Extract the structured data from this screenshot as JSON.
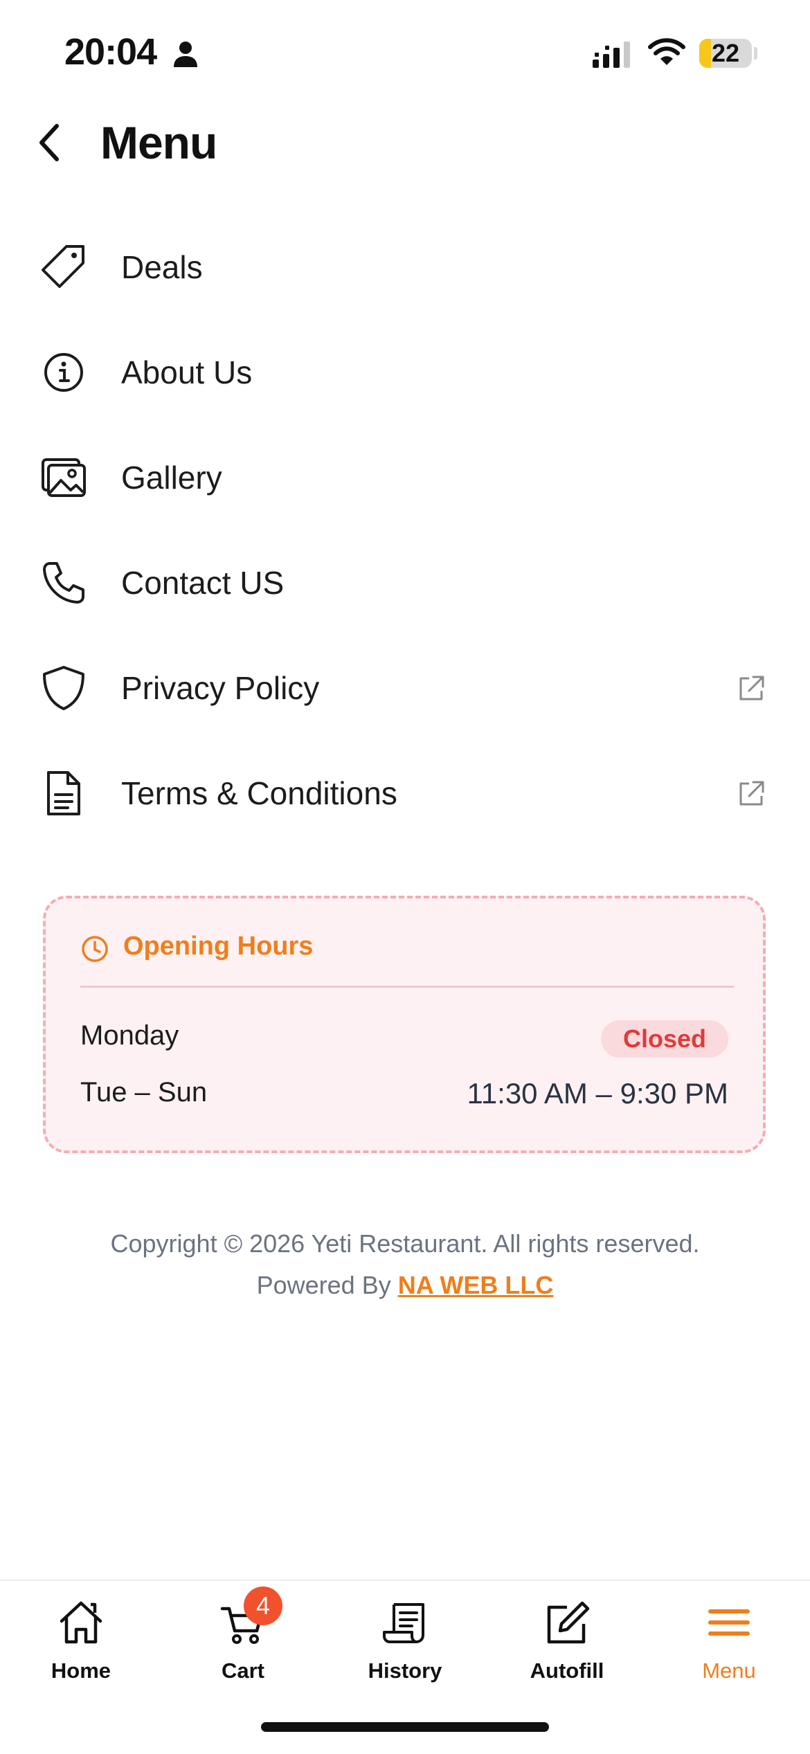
{
  "status_bar": {
    "time": "20:04",
    "battery_level": "22",
    "battery_fraction": 0.22,
    "icons": [
      "person-icon",
      "signal-icon",
      "wifi-icon",
      "battery-icon"
    ]
  },
  "header": {
    "title": "Menu",
    "back_icon": "chevron-left-icon"
  },
  "menu": {
    "items": [
      {
        "label": "Deals",
        "icon": "tag-icon",
        "external": false
      },
      {
        "label": "About Us",
        "icon": "info-icon",
        "external": false
      },
      {
        "label": "Gallery",
        "icon": "image-icon",
        "external": false
      },
      {
        "label": "Contact US",
        "icon": "phone-icon",
        "external": false
      },
      {
        "label": "Privacy Policy",
        "icon": "shield-icon",
        "external": true
      },
      {
        "label": "Terms & Conditions",
        "icon": "document-icon",
        "external": true
      }
    ]
  },
  "opening_hours": {
    "title": "Opening Hours",
    "rows": [
      {
        "day": "Monday",
        "status": "Closed"
      },
      {
        "day": "Tue – Sun",
        "hours": "11:30 AM – 9:30 PM"
      }
    ]
  },
  "footer": {
    "copyright": "Copyright © 2026 Yeti Restaurant. All rights reserved.",
    "powered_prefix": "Powered By",
    "powered_link": "NA WEB LLC"
  },
  "tab_bar": {
    "tabs": [
      {
        "label": "Home",
        "icon": "home-icon"
      },
      {
        "label": "Cart",
        "icon": "cart-icon",
        "badge": "4"
      },
      {
        "label": "History",
        "icon": "receipt-icon"
      },
      {
        "label": "Autofill",
        "icon": "edit-icon"
      },
      {
        "label": "Menu",
        "icon": "hamburger-icon",
        "active": true
      }
    ]
  },
  "colors": {
    "accent": "#f07e1b",
    "closed_text": "#e03a3a",
    "card_background": "#fdf1f3",
    "card_border": "#f2aeb3",
    "badge": "#f2512e"
  }
}
